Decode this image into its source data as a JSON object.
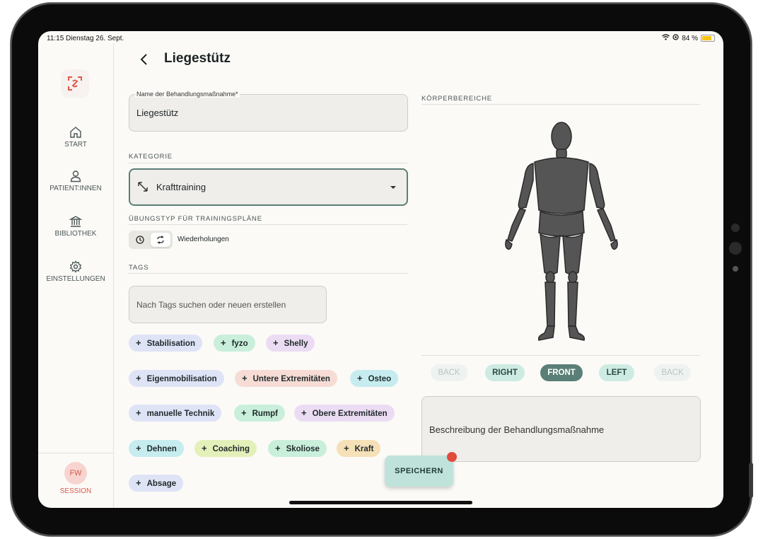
{
  "status_bar": {
    "time_date": "11:15  Dienstag 26. Sept.",
    "battery": "84 %"
  },
  "sidebar": {
    "items": [
      {
        "label": "START",
        "icon": "home-icon"
      },
      {
        "label": "PATIENT:INNEN",
        "icon": "person-icon"
      },
      {
        "label": "BIBLIOTHEK",
        "icon": "library-icon"
      },
      {
        "label": "EINSTELLUNGEN",
        "icon": "gear-icon"
      }
    ],
    "session": {
      "initials": "FW",
      "label": "SESSION"
    }
  },
  "header": {
    "title": "Liegestütz"
  },
  "form": {
    "name_label": "Name der Behandlungsmaßnahme*",
    "name_value": "Liegestütz",
    "category_label": "KATEGORIE",
    "category_value": "Krafttraining",
    "exercise_type_label": "ÜBUNGSTYP FÜR TRAININGSPLÄNE",
    "exercise_type_value": "Wiederholungen",
    "tags_label": "TAGS",
    "tags_placeholder": "Nach Tags suchen oder neuen erstellen",
    "tags": [
      {
        "label": "Stabilisation",
        "color": "#dfe3f6"
      },
      {
        "label": "fyzo",
        "color": "#c9efdb"
      },
      {
        "label": "Shelly",
        "color": "#ecdcf3"
      },
      {
        "label": "Eigenmobilisation",
        "color": "#dfe3f6"
      },
      {
        "label": "Untere Extremitäten",
        "color": "#f7dcd6"
      },
      {
        "label": "Osteo",
        "color": "#c6ecef"
      },
      {
        "label": "manuelle Technik",
        "color": "#dfe3f6"
      },
      {
        "label": "Rumpf",
        "color": "#c9efdb"
      },
      {
        "label": "Obere Extremitäten",
        "color": "#ecdcf3"
      },
      {
        "label": "Dehnen",
        "color": "#c6ecef"
      },
      {
        "label": "Coaching",
        "color": "#e4f0b9"
      },
      {
        "label": "Skoliose",
        "color": "#c9efdb"
      },
      {
        "label": "Kraft",
        "color": "#f6e0b7"
      },
      {
        "label": "Absage",
        "color": "#dfe3f6"
      }
    ]
  },
  "body_regions": {
    "label": "KÖRPERBEREICHE",
    "views": [
      {
        "label": "BACK",
        "state": "disabled"
      },
      {
        "label": "RIGHT",
        "state": "normal"
      },
      {
        "label": "FRONT",
        "state": "active"
      },
      {
        "label": "LEFT",
        "state": "normal"
      },
      {
        "label": "BACK",
        "state": "disabled"
      }
    ]
  },
  "description_placeholder": "Beschreibung der Behandlungsmaßnahme",
  "save_label": "SPEICHERN",
  "colors": {
    "accent": "#5a7f76",
    "brand": "#e05a4a",
    "save_bg": "#bfe3da"
  }
}
